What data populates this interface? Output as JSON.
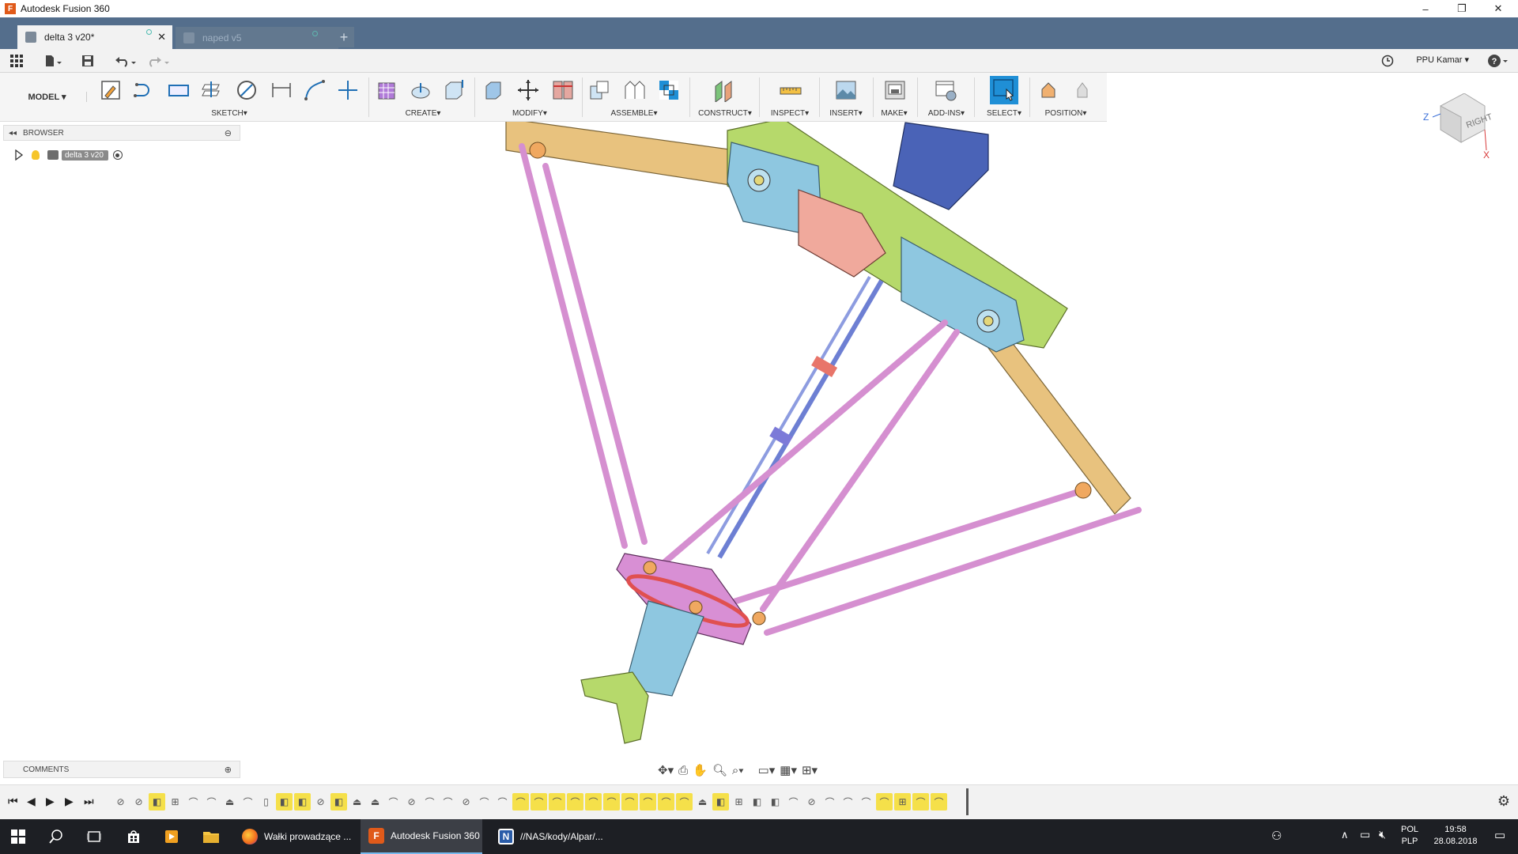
{
  "window": {
    "title": "Autodesk Fusion 360",
    "logo_letter": "F",
    "minimize": "–",
    "maximize": "❐",
    "close": "✕"
  },
  "tabs": [
    {
      "label": "delta 3 v20*",
      "active": true
    },
    {
      "label": "naped v5",
      "active": false
    }
  ],
  "new_tab": "+",
  "user": {
    "name": "PPU Kamar",
    "help": "?"
  },
  "ribbon": {
    "workspace": "MODEL",
    "groups": [
      {
        "label": "SKETCH",
        "arrow": "▾"
      },
      {
        "label": "CREATE",
        "arrow": "▾"
      },
      {
        "label": "MODIFY",
        "arrow": "▾"
      },
      {
        "label": "ASSEMBLE",
        "arrow": "▾"
      },
      {
        "label": "CONSTRUCT",
        "arrow": "▾"
      },
      {
        "label": "INSPECT",
        "arrow": "▾"
      },
      {
        "label": "INSERT",
        "arrow": "▾"
      },
      {
        "label": "MAKE",
        "arrow": "▾"
      },
      {
        "label": "ADD-INS",
        "arrow": "▾"
      },
      {
        "label": "SELECT",
        "arrow": "▾"
      },
      {
        "label": "POSITION",
        "arrow": "▾"
      }
    ]
  },
  "browser": {
    "title": "BROWSER",
    "component": "delta 3 v20"
  },
  "comments": {
    "title": "COMMENTS"
  },
  "viewcube": {
    "face": "RIGHT",
    "axis_z": "Z",
    "axis_x": "X"
  },
  "taskbar": {
    "apps": [
      {
        "label": "Wałki prowadzące ...",
        "icon": "firefox-icon",
        "active": false
      },
      {
        "label": "Autodesk Fusion 360",
        "icon": "fusion-icon",
        "active": true
      },
      {
        "label": "//NAS/kody/Alpar/...",
        "icon": "editor-icon",
        "active": false
      }
    ],
    "lang_top": "POL",
    "lang_bottom": "PLP",
    "time": "19:58",
    "date": "28.08.2018"
  },
  "colors": {
    "tab_bar": "#546e8c",
    "select_accent": "#1f8fd6",
    "arm_tan": "#e8c27e",
    "rod_pink": "#d58fd0",
    "body_green": "#b6d96b",
    "motor_blue": "#4a63b7",
    "part_lightblue": "#8ec7e0"
  }
}
